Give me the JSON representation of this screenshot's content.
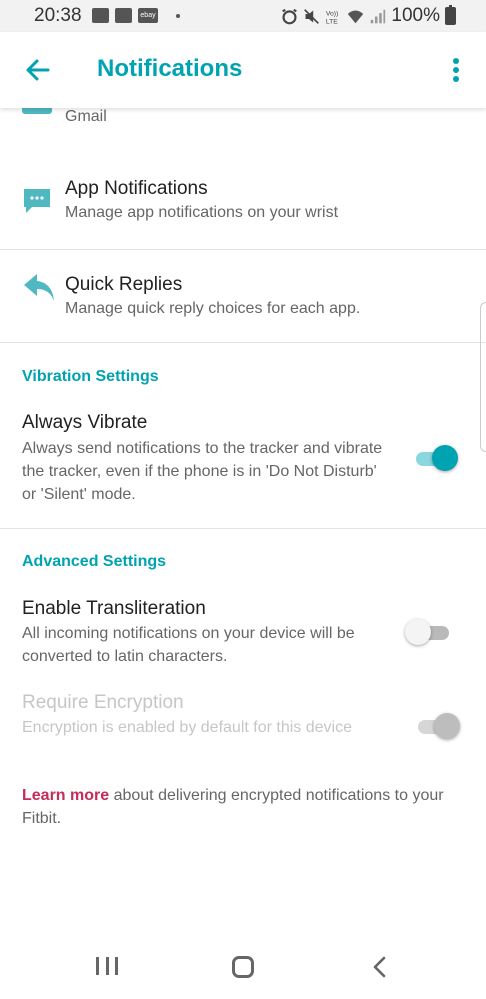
{
  "status_bar": {
    "time": "20:38",
    "ebay_label": "ebay",
    "volte_label": "Vo)) LTE",
    "battery": "100%"
  },
  "app_bar": {
    "title": "Notifications",
    "back_icon": "arrow-left-icon",
    "menu_icon": "more-vert-icon"
  },
  "list": {
    "gmail_subtitle": "Gmail",
    "app_notifications": {
      "title": "App Notifications",
      "subtitle": "Manage app notifications on your wrist",
      "icon": "chat-bubble-icon"
    },
    "quick_replies": {
      "title": "Quick Replies",
      "subtitle": "Manage quick reply choices for each app.",
      "icon": "reply-icon"
    }
  },
  "vibration_settings": {
    "header": "Vibration Settings",
    "always_vibrate": {
      "title": "Always Vibrate",
      "description": "Always send notifications to the tracker and vibrate the tracker, even if the phone is in 'Do Not Disturb' or 'Silent' mode.",
      "enabled": true
    }
  },
  "advanced_settings": {
    "header": "Advanced Settings",
    "transliteration": {
      "title": "Enable Transliteration",
      "description": "All incoming notifications on your device will be converted to latin characters.",
      "enabled": false
    },
    "encryption": {
      "title": "Require Encryption",
      "description": "Encryption is enabled by default for this device",
      "enabled": true,
      "disabled": true
    },
    "learn_more": {
      "link": "Learn more",
      "text": " about delivering encrypted notifications to your Fitbit."
    }
  },
  "colors": {
    "accent": "#00a3b0",
    "link": "#c42c5a"
  }
}
